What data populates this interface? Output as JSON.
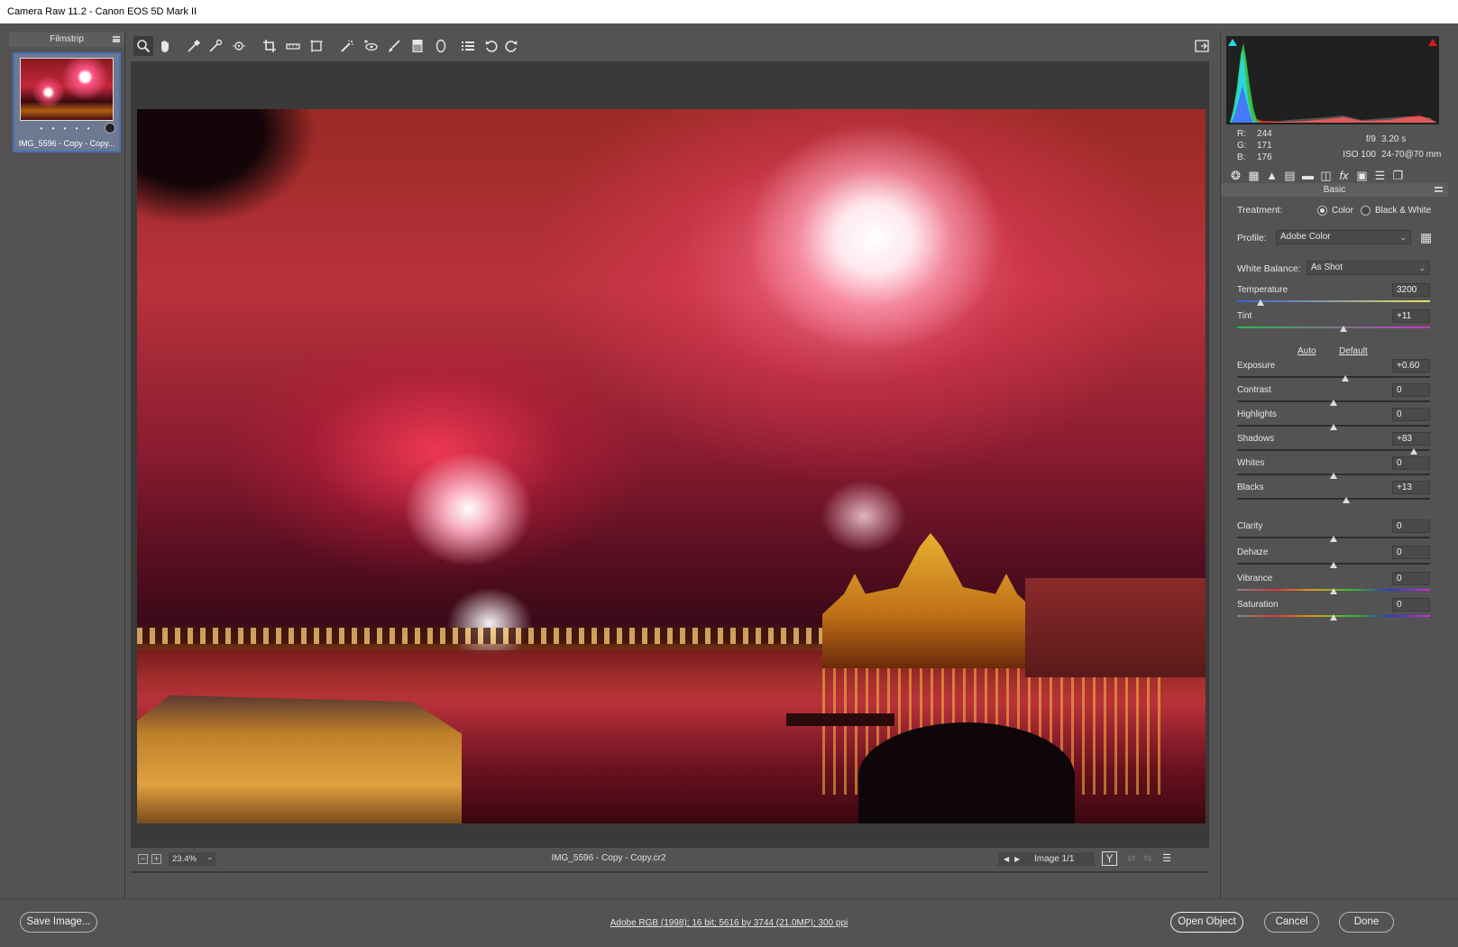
{
  "window": {
    "title": "Camera Raw 11.2  -  Canon EOS 5D Mark II"
  },
  "filmstrip": {
    "header": "Filmstrip",
    "thumb_label": "IMG_5596 - Copy - Copy...",
    "rating_dots": "• • • • •"
  },
  "toolbar": {
    "tools": [
      "zoom-icon",
      "hand-icon",
      "white-balance-icon",
      "color-sampler-icon",
      "targeted-adjustment-icon",
      "crop-icon",
      "straighten-icon",
      "transform-icon",
      "spot-removal-icon",
      "red-eye-icon",
      "adjustment-brush-icon",
      "graduated-filter-icon",
      "radial-filter-icon",
      "preferences-icon",
      "rotate-left-icon",
      "rotate-right-icon"
    ],
    "fullscreen_icon": "fullscreen-icon"
  },
  "status": {
    "zoom_minus": "−",
    "zoom_plus": "+",
    "zoom": "23.4%",
    "filename": "IMG_5596 - Copy - Copy.cr2",
    "image_counter": "Image 1/1",
    "y_toggle": "Y"
  },
  "histogram": {
    "r_label": "R:",
    "r": "244",
    "g_label": "G:",
    "g": "171",
    "b_label": "B:",
    "b": "176",
    "aperture": "f/9",
    "shutter": "3.20 s",
    "iso": "ISO 100",
    "lens": "24-70@70 mm"
  },
  "panel": {
    "title": "Basic",
    "treatment_label": "Treatment:",
    "treatment_color": "Color",
    "treatment_bw": "Black & White",
    "profile_label": "Profile:",
    "profile_value": "Adobe Color",
    "wb_label": "White Balance:",
    "wb_value": "As Shot",
    "auto": "Auto",
    "default": "Default",
    "sliders": [
      {
        "label": "Temperature",
        "value": "3200",
        "pos": 0.12
      },
      {
        "label": "Tint",
        "value": "+11",
        "pos": 0.55
      },
      {
        "label": "Exposure",
        "value": "+0.60",
        "pos": 0.56
      },
      {
        "label": "Contrast",
        "value": "0",
        "pos": 0.5
      },
      {
        "label": "Highlights",
        "value": "0",
        "pos": 0.5
      },
      {
        "label": "Shadows",
        "value": "+83",
        "pos": 0.915
      },
      {
        "label": "Whites",
        "value": "0",
        "pos": 0.5
      },
      {
        "label": "Blacks",
        "value": "+13",
        "pos": 0.565
      },
      {
        "label": "Clarity",
        "value": "0",
        "pos": 0.5
      },
      {
        "label": "Dehaze",
        "value": "0",
        "pos": 0.5
      },
      {
        "label": "Vibrance",
        "value": "0",
        "pos": 0.5
      },
      {
        "label": "Saturation",
        "value": "0",
        "pos": 0.5
      }
    ]
  },
  "bottom": {
    "save_image": "Save Image...",
    "workflow": "Adobe RGB (1998); 16 bit; 5616 by 3744 (21.0MP); 300 ppi",
    "open_object": "Open Object",
    "cancel": "Cancel",
    "done": "Done"
  },
  "colors": {
    "panel_bg": "#535353",
    "preview_bg": "#3a3a3a",
    "selection": "#4a6fb8"
  }
}
